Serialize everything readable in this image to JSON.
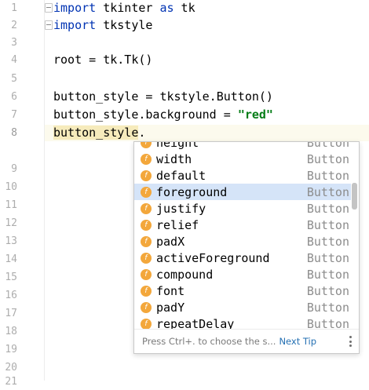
{
  "editor": {
    "line_numbers": [
      "1",
      "2",
      "3",
      "4",
      "5",
      "6",
      "7",
      "8",
      "9",
      "10",
      "11",
      "12",
      "13",
      "14",
      "15",
      "16",
      "17",
      "18",
      "19",
      "20",
      "21"
    ],
    "code": {
      "line1": {
        "kw1": "import",
        "rest": " tkinter ",
        "kw2": "as",
        "rest2": " tk"
      },
      "line2": {
        "kw1": "import",
        "rest": " tkstyle"
      },
      "line4": "root = tk.Tk()",
      "line6": "button_style = tkstyle.Button()",
      "line7": {
        "prefix": "button_style.background = ",
        "string": "\"red\""
      },
      "line8": {
        "token": "button_style",
        "suffix": "."
      }
    }
  },
  "completion_popup": {
    "icon_letter": "f",
    "items": [
      {
        "name": "height",
        "type": "Button"
      },
      {
        "name": "width",
        "type": "Button"
      },
      {
        "name": "default",
        "type": "Button"
      },
      {
        "name": "foreground",
        "type": "Button",
        "selected": true
      },
      {
        "name": "justify",
        "type": "Button"
      },
      {
        "name": "relief",
        "type": "Button"
      },
      {
        "name": "padX",
        "type": "Button"
      },
      {
        "name": "activeForeground",
        "type": "Button"
      },
      {
        "name": "compound",
        "type": "Button"
      },
      {
        "name": "font",
        "type": "Button"
      },
      {
        "name": "padY",
        "type": "Button"
      },
      {
        "name": "repeatDelay",
        "type": "Button"
      }
    ],
    "footer_hint": "Press Ctrl+. to choose the s...",
    "footer_link": "Next Tip"
  }
}
